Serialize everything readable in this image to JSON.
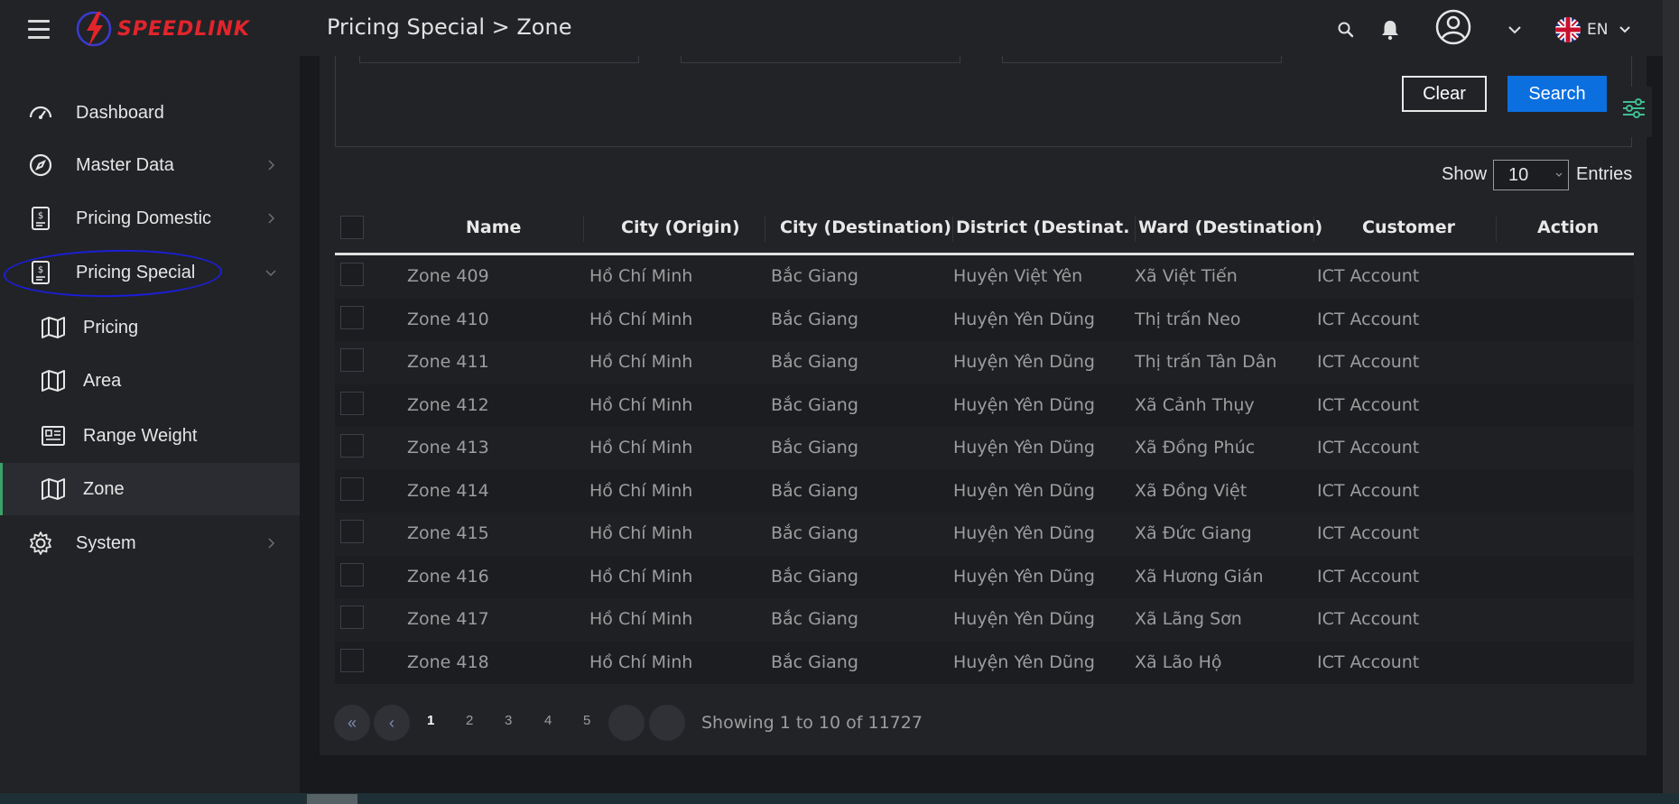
{
  "app": {
    "brand": "SPEEDLINK",
    "brand_color": "#e3242b",
    "accent": "#0b6fe0",
    "breadcrumb": "Pricing Special > Zone",
    "language": "EN"
  },
  "sidebar": {
    "items": [
      {
        "label": "Dashboard",
        "icon": "speedometer-icon"
      },
      {
        "label": "Master Data",
        "icon": "compass-icon"
      },
      {
        "label": "Pricing Domestic",
        "icon": "invoice-icon"
      },
      {
        "label": "Pricing Special",
        "icon": "invoice-icon",
        "expanded": true
      },
      {
        "label": "Pricing",
        "icon": "map-icon"
      },
      {
        "label": "Area",
        "icon": "map-icon"
      },
      {
        "label": "Range Weight",
        "icon": "newspaper-icon"
      },
      {
        "label": "Zone",
        "icon": "map-icon",
        "active": true
      },
      {
        "label": "System",
        "icon": "gear-icon"
      }
    ]
  },
  "filters": {
    "clear_label": "Clear",
    "search_label": "Search"
  },
  "table_controls": {
    "show_label": "Show",
    "page_size": "10",
    "entries_label": "Entries"
  },
  "table": {
    "columns": [
      "Name",
      "City (Origin)",
      "City (Destination)",
      "District (Destinat...",
      "Ward (Destination)",
      "Customer",
      "Action"
    ],
    "rows": [
      [
        "Zone 409",
        "Hồ Chí Minh",
        "Bắc Giang",
        "Huyện Việt Yên",
        "Xã Việt Tiến",
        "ICT Account"
      ],
      [
        "Zone 410",
        "Hồ Chí Minh",
        "Bắc Giang",
        "Huyện Yên Dũng",
        "Thị trấn Neo",
        "ICT Account"
      ],
      [
        "Zone 411",
        "Hồ Chí Minh",
        "Bắc Giang",
        "Huyện Yên Dũng",
        "Thị trấn Tân Dân",
        "ICT Account"
      ],
      [
        "Zone 412",
        "Hồ Chí Minh",
        "Bắc Giang",
        "Huyện Yên Dũng",
        "Xã Cảnh Thụy",
        "ICT Account"
      ],
      [
        "Zone 413",
        "Hồ Chí Minh",
        "Bắc Giang",
        "Huyện Yên Dũng",
        "Xã Đồng Phúc",
        "ICT Account"
      ],
      [
        "Zone 414",
        "Hồ Chí Minh",
        "Bắc Giang",
        "Huyện Yên Dũng",
        "Xã Đồng Việt",
        "ICT Account"
      ],
      [
        "Zone 415",
        "Hồ Chí Minh",
        "Bắc Giang",
        "Huyện Yên Dũng",
        "Xã Đức Giang",
        "ICT Account"
      ],
      [
        "Zone 416",
        "Hồ Chí Minh",
        "Bắc Giang",
        "Huyện Yên Dũng",
        "Xã Hương Gián",
        "ICT Account"
      ],
      [
        "Zone 417",
        "Hồ Chí Minh",
        "Bắc Giang",
        "Huyện Yên Dũng",
        "Xã Lãng Sơn",
        "ICT Account"
      ],
      [
        "Zone 418",
        "Hồ Chí Minh",
        "Bắc Giang",
        "Huyện Yên Dũng",
        "Xã Lão Hộ",
        "ICT Account"
      ]
    ]
  },
  "pagination": {
    "first": "«",
    "prev": "‹",
    "pages": [
      "1",
      "2",
      "3",
      "4",
      "5"
    ],
    "current_page": "1",
    "summary": "Showing 1 to 10 of 11727"
  }
}
